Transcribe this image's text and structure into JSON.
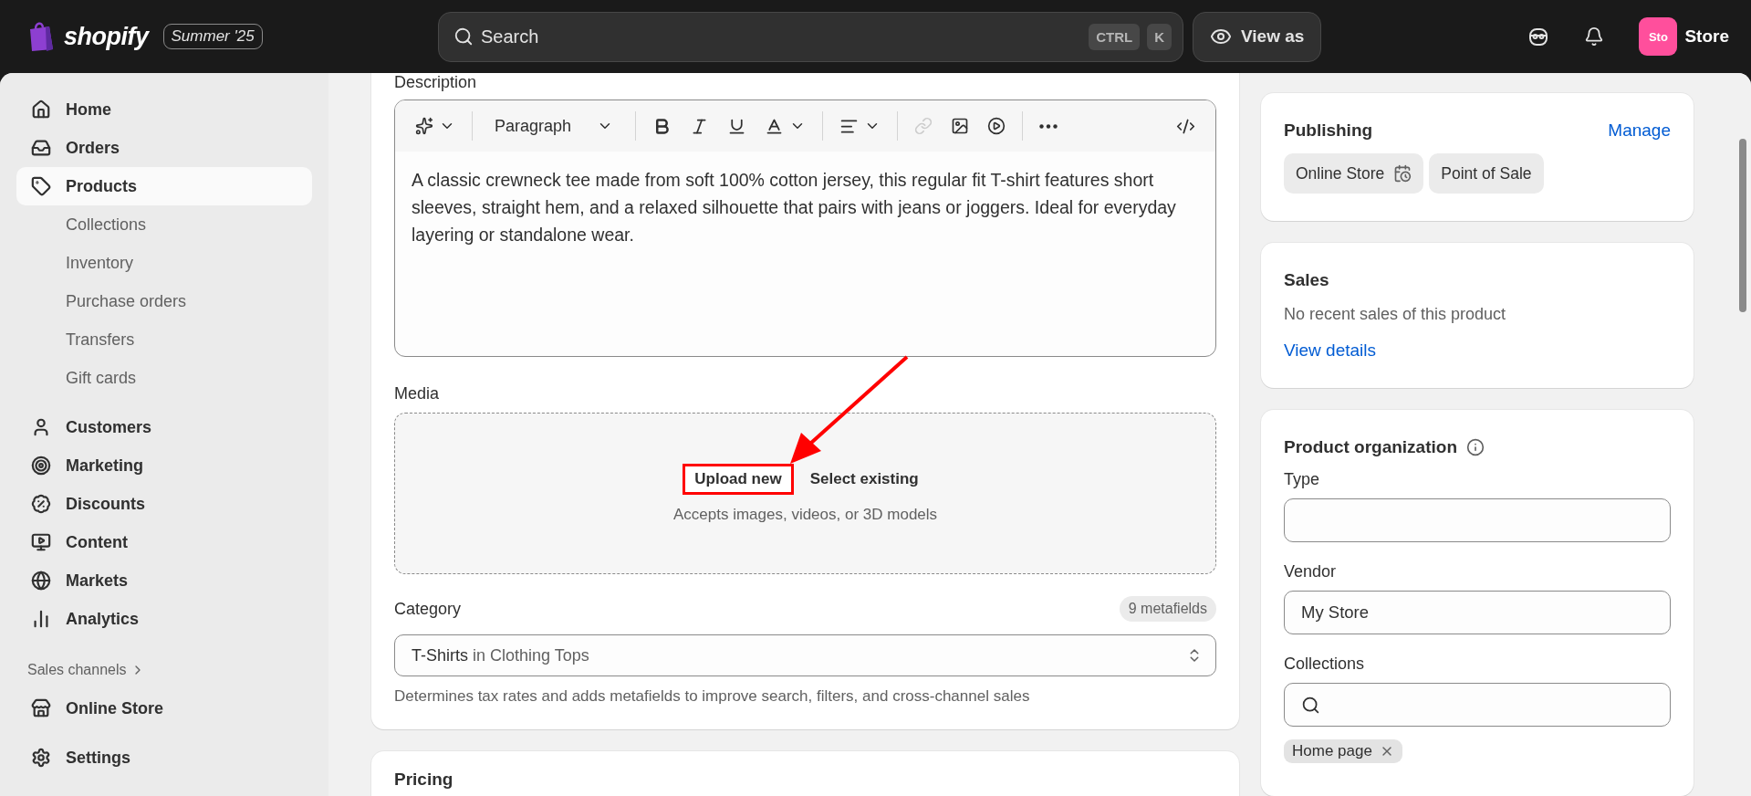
{
  "topbar": {
    "logo": "shopify",
    "badge": "Summer '25",
    "search": {
      "placeholder": "Search",
      "keys": [
        "CTRL",
        "K"
      ]
    },
    "view_as": "View as",
    "store": {
      "initials": "Sto",
      "name": "Store"
    }
  },
  "sidebar": {
    "items": [
      {
        "label": "Home",
        "selected": false
      },
      {
        "label": "Orders",
        "selected": false
      },
      {
        "label": "Products",
        "selected": true,
        "children": [
          {
            "label": "Collections",
            "selected": false
          },
          {
            "label": "Inventory",
            "selected": false
          },
          {
            "label": "Purchase orders",
            "selected": false
          },
          {
            "label": "Transfers",
            "selected": false
          },
          {
            "label": "Gift cards",
            "selected": false
          }
        ]
      },
      {
        "label": "Customers",
        "selected": false
      },
      {
        "label": "Marketing",
        "selected": false
      },
      {
        "label": "Discounts",
        "selected": false
      },
      {
        "label": "Content",
        "selected": false
      },
      {
        "label": "Markets",
        "selected": false
      },
      {
        "label": "Analytics",
        "selected": false
      }
    ],
    "sales_channels": {
      "title": "Sales channels",
      "items": [
        {
          "label": "Online Store",
          "selected": false
        }
      ]
    },
    "footer_items": [
      {
        "label": "Settings",
        "selected": false
      }
    ]
  },
  "product": {
    "description": {
      "label": "Description",
      "toolbar": {
        "format": "Paragraph",
        "link": {
          "disabled": true
        }
      },
      "text": "A classic crewneck tee made from soft 100% cotton jersey, this regular fit T-shirt features short sleeves, straight hem, and a relaxed silhouette that pairs with jeans or joggers. Ideal for everyday layering or standalone wear."
    },
    "media": {
      "label": "Media",
      "upload": {
        "label": "Upload new",
        "highlighted": true
      },
      "select": "Select existing",
      "hint": "Accepts images, videos, or 3D models"
    },
    "category": {
      "label": "Category",
      "badge": "9 metafields",
      "value": "T-Shirts",
      "path": "in Clothing Tops",
      "help": "Determines tax rates and adds metafields to improve search, filters, and cross-channel sales"
    },
    "pricing": {
      "title": "Pricing"
    }
  },
  "publishing": {
    "title": "Publishing",
    "action": "Manage",
    "channels": [
      {
        "label": "Online Store",
        "scheduled": true
      },
      {
        "label": "Point of Sale",
        "scheduled": false
      }
    ]
  },
  "sales": {
    "title": "Sales",
    "text": "No recent sales of this product",
    "link": "View details"
  },
  "organization": {
    "title": "Product organization",
    "fields": [
      {
        "kind": "text",
        "label": "Type"
      },
      {
        "kind": "text",
        "label": "Vendor",
        "value": "My Store"
      },
      {
        "kind": "search",
        "label": "Collections",
        "tags": [
          "Home page"
        ]
      }
    ]
  }
}
